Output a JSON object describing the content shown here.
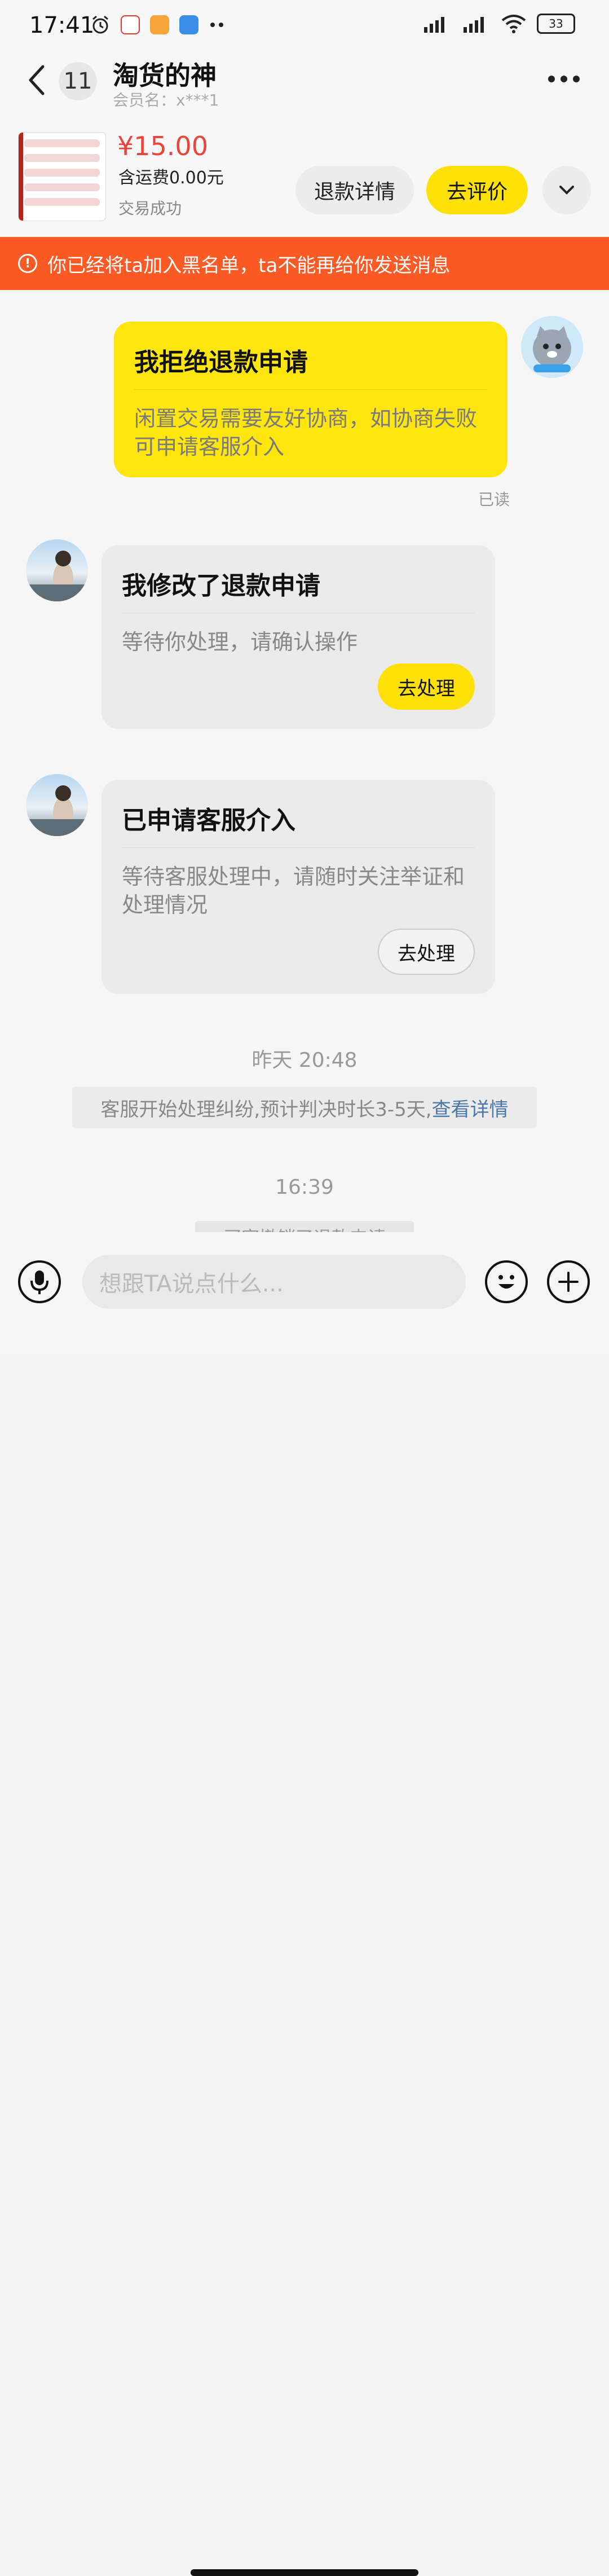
{
  "status_bar": {
    "time": "17:41",
    "battery": "33"
  },
  "header": {
    "unread_count": "11",
    "title": "淘货的神",
    "subtitle": "会员名：x***1"
  },
  "order": {
    "price": "¥15.00",
    "shipping": "含运费0.00元",
    "state": "交易成功",
    "refund_detail_label": "退款详情",
    "review_label": "去评价"
  },
  "banner": {
    "text": "你已经将ta加入黑名单，ta不能再给你发送消息"
  },
  "messages": [
    {
      "title": "我拒绝退款申请",
      "body": "闲置交易需要友好协商，如协商失败可申请客服介入"
    },
    {
      "title": "我修改了退款申请",
      "body": "等待你处理，请确认操作",
      "action": "去处理"
    },
    {
      "title": "已申请客服介入",
      "body": "等待客服处理中，请随时关注举证和处理情况",
      "action": "去处理"
    }
  ],
  "read_status": "已读",
  "timestamps": [
    "昨天 20:48",
    "16:39"
  ],
  "system_message": {
    "text": "客服开始处理纠纷,预计判决时长3-5天,",
    "link": "查看详情"
  },
  "partial_message": "买家撤销了退款申请",
  "input": {
    "placeholder": "想跟TA说点什么..."
  },
  "colors": {
    "accent_yellow": "#ffe10a",
    "banner_orange": "#fb5a24",
    "price_red": "#e8453b",
    "link_blue": "#4a78a8"
  }
}
